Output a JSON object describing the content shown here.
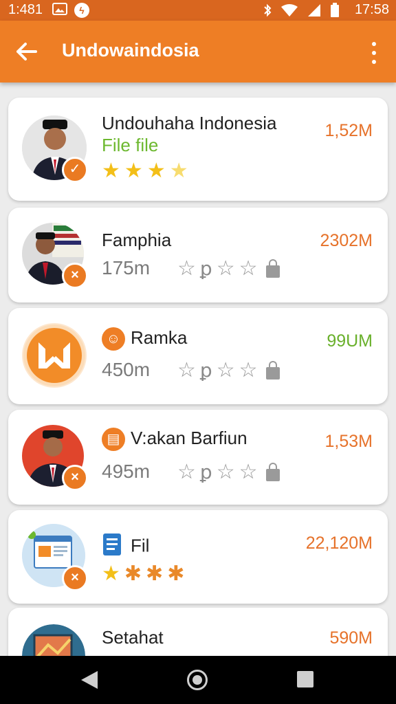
{
  "status_bar": {
    "time_left": "1:481",
    "time_right": "17:58",
    "icons_left": [
      "image-icon",
      "bolt-icon"
    ],
    "icons_right": [
      "bluetooth-icon",
      "wifi-icon",
      "signal-icon",
      "battery-icon"
    ]
  },
  "app_bar": {
    "title": "Undowaindosia",
    "back_icon": "arrow-left-icon",
    "menu_icon": "more-vert-icon"
  },
  "colors": {
    "status_bar": "#d9661f",
    "app_bar": "#ee7e25",
    "accent_orange": "#e6722a",
    "accent_green": "#69b02b",
    "star_yellow": "#f3bf18"
  },
  "items": [
    {
      "title": "Undouhaha Indonesia",
      "subtitle": "File file",
      "size": "1,52M",
      "rating_filled": 3.5,
      "badge": "check",
      "badge_glyph": "✓",
      "icon": "person-avatar-icon"
    },
    {
      "title": "Famphia",
      "meta": "175m",
      "size": "2302M",
      "badge": "x",
      "badge_glyph": "×",
      "glyph": "ꝑ",
      "icon": "person-avatar-icon"
    },
    {
      "title": "Ramka",
      "meta": "450m",
      "size": "99UM",
      "badge": "",
      "glyph": "ꝑ",
      "icon": "envelope-logo-icon",
      "title_icon": "smile-icon",
      "title_icon_glyph": "☺"
    },
    {
      "title": "V:akan Barfiun",
      "meta": "495m",
      "size": "1,53M",
      "badge": "x",
      "badge_glyph": "×",
      "glyph": "ꝑ",
      "icon": "person-avatar-icon",
      "title_icon": "clipboard-icon",
      "title_icon_glyph": "▤"
    },
    {
      "title": "Fil",
      "size": "22,120M",
      "badge": "x",
      "badge_glyph": "×",
      "icon": "webpage-icon",
      "title_icon": "document-icon",
      "rating_filled": 1
    },
    {
      "title": "Setahat",
      "size": "590M",
      "icon": "painting-icon"
    }
  ],
  "nav_bar": {
    "back_icon": "nav-back-icon",
    "home_icon": "nav-home-icon",
    "recents_icon": "nav-recents-icon"
  }
}
